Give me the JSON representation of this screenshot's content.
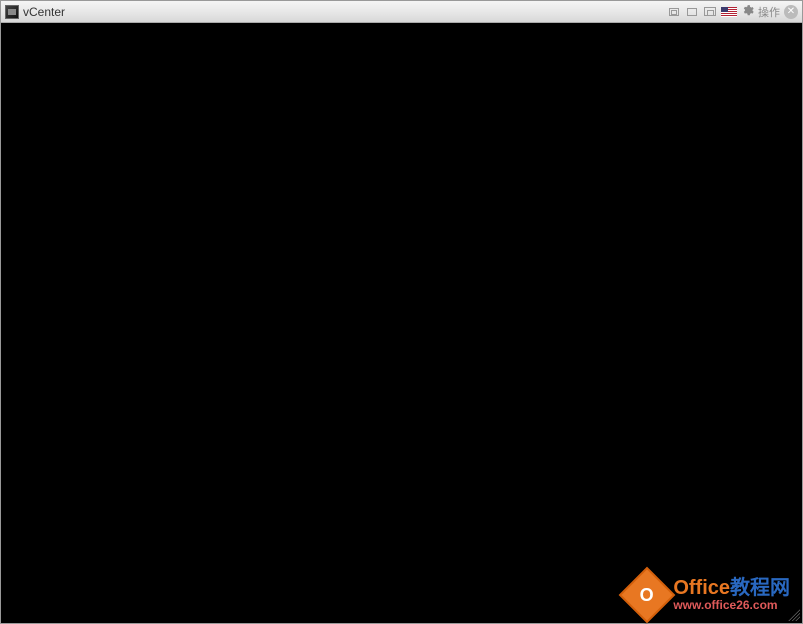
{
  "titlebar": {
    "title": "vCenter",
    "actions_label": "操作"
  },
  "watermark": {
    "badge_text": "O",
    "line1_brand": "Office",
    "line1_suffix": "教程网",
    "line2": "www.office26.com"
  }
}
